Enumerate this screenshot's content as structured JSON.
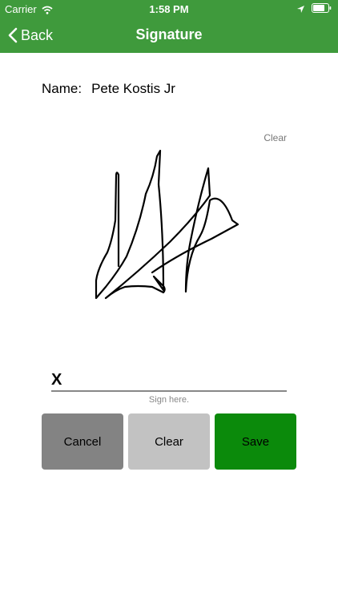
{
  "status_bar": {
    "carrier": "Carrier",
    "time": "1:58 PM",
    "icons": [
      "wifi-icon",
      "location-icon",
      "battery-icon"
    ]
  },
  "nav": {
    "back_label": "Back",
    "title": "Signature",
    "back_icon": "chevron-left-icon"
  },
  "form": {
    "name_label": "Name:",
    "name_value": "Pete Kostis Jr",
    "clear_link": "Clear",
    "sign_mark": "X",
    "sign_hint": "Sign here."
  },
  "buttons": {
    "cancel": "Cancel",
    "clear": "Clear",
    "save": "Save"
  },
  "colors": {
    "header": "#3f9a3c",
    "cancel": "#838383",
    "clear": "#c2c2c2",
    "save": "#0b8a0b"
  }
}
